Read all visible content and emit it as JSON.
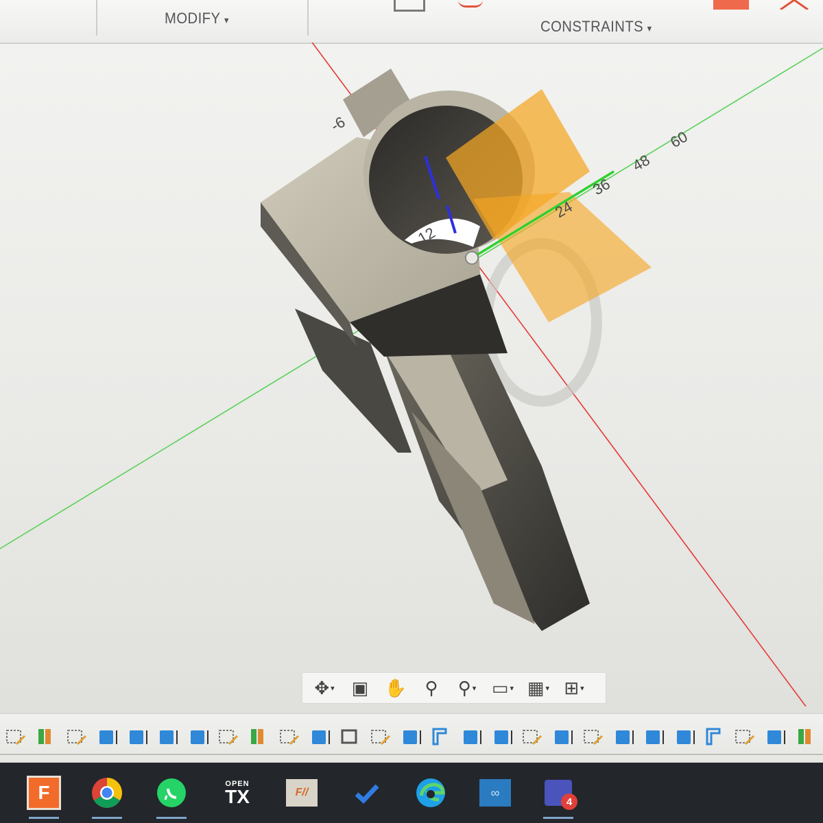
{
  "toolbar": {
    "modify_label": "MODIFY",
    "constraints_label": "CONSTRAINTS",
    "caret": "▾"
  },
  "viewport": {
    "grid_labels": [
      "-6",
      "12",
      "24",
      "36",
      "48",
      "60"
    ],
    "colors": {
      "background": "#ececea",
      "model_face_light": "#c7c2b2",
      "model_face_mid": "#8a8579",
      "model_face_dark": "#3c3a36",
      "axis_x": "#e53935",
      "axis_y": "#43c843",
      "axis_z": "#2d2fe0",
      "sketch_plane": "#f5a623"
    }
  },
  "nav_bar": {
    "icons": [
      "orbit-icon",
      "look-at-icon",
      "pan-icon",
      "zoom-icon",
      "zoom-window-icon",
      "display-settings-icon",
      "grid-icon",
      "viewports-icon"
    ]
  },
  "timeline": {
    "items": [
      "sketch",
      "feature",
      "sketch",
      "body",
      "body",
      "body",
      "body",
      "sketch",
      "feature",
      "sketch",
      "body",
      "combine",
      "sketch",
      "body",
      "plane",
      "body",
      "body",
      "sketch",
      "body",
      "sketch",
      "body",
      "body",
      "constraint",
      "plane",
      "sketch",
      "body",
      "feature"
    ]
  },
  "taskbar": {
    "apps": [
      {
        "name": "Fusion 360",
        "label": "F",
        "color": "#f26b2a"
      },
      {
        "name": "Chrome",
        "label": "",
        "color": "#4285f4"
      },
      {
        "name": "WhatsApp",
        "label": "",
        "color": "#25d366"
      },
      {
        "name": "OpenTX",
        "label_top": "OPEN",
        "label_bottom": "TX",
        "color": "#ffffff"
      },
      {
        "name": "Fusion app",
        "label": "",
        "color": "#d9d4c8"
      },
      {
        "name": "To Do",
        "label": "",
        "color": "#2f7de1"
      },
      {
        "name": "Edge",
        "label": "",
        "color": "#1fa0e6"
      },
      {
        "name": "Arduino",
        "label": "",
        "color": "#2b7bc0"
      },
      {
        "name": "Teams",
        "label": "",
        "badge": "4",
        "color": "#4b53bc"
      }
    ]
  }
}
